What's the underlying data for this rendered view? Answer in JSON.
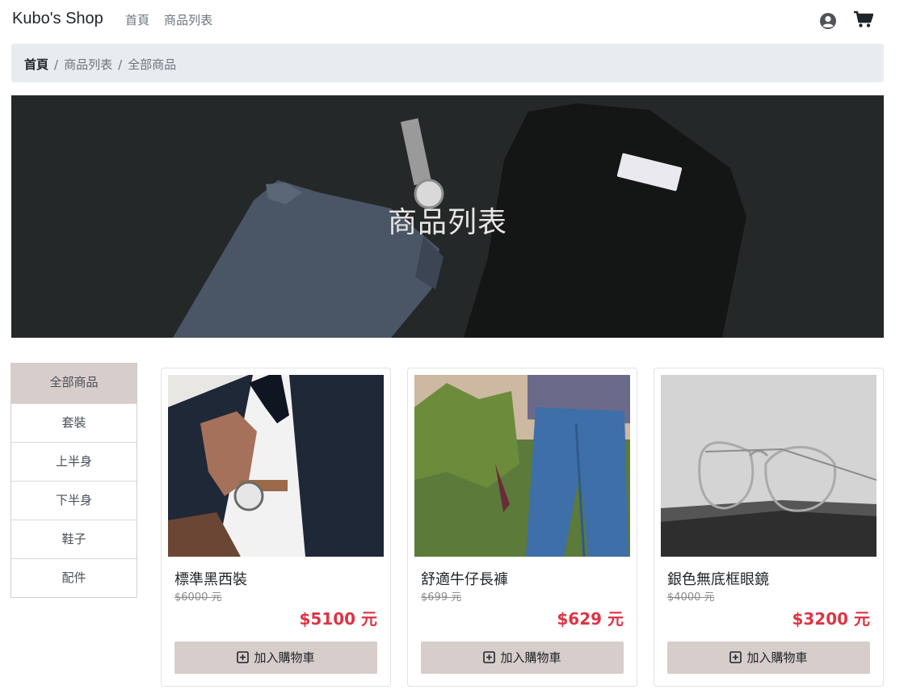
{
  "navbar": {
    "brand": "Kubo's Shop",
    "links": [
      "首頁",
      "商品列表"
    ],
    "icons": [
      "user-circle-icon",
      "shopping-cart-icon"
    ]
  },
  "breadcrumb": {
    "items": [
      "首頁",
      "商品列表",
      "全部商品"
    ],
    "separator": "/"
  },
  "hero": {
    "title": "商品列表",
    "background_color": "#242626"
  },
  "sidebar": {
    "items": [
      "全部商品",
      "套裝",
      "上半身",
      "下半身",
      "鞋子",
      "配件"
    ],
    "active_index": 0,
    "active_color": "#d7cdcb"
  },
  "products": [
    {
      "name": "標準黑西裝",
      "original_price": "$6000 元",
      "price": "$5100 元",
      "button": "加入購物車"
    },
    {
      "name": "舒適牛仔長褲",
      "original_price": "$699 元",
      "price": "$629 元",
      "button": "加入購物車"
    },
    {
      "name": "銀色無底框眼鏡",
      "original_price": "$4000 元",
      "price": "$3200 元",
      "button": "加入購物車"
    }
  ],
  "colors": {
    "price": "#dc3545",
    "button_bg": "#d7cdcb",
    "breadcrumb_bg": "#e9ecef"
  }
}
